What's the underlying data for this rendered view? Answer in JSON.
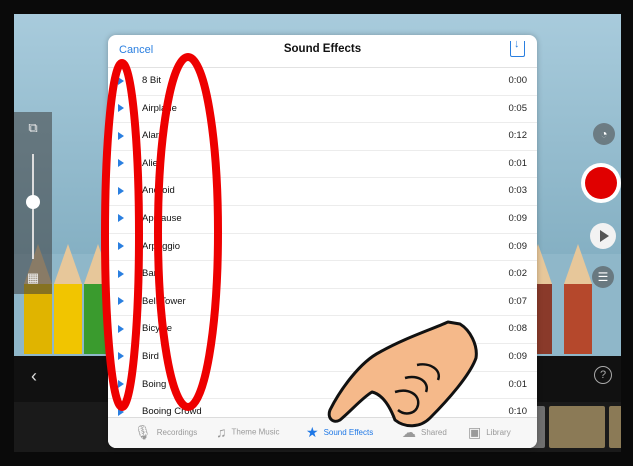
{
  "header": {
    "cancel_label": "Cancel",
    "title": "Sound Effects",
    "import_icon": "import-icon"
  },
  "sounds": [
    {
      "name": "8 Bit",
      "duration": "0:00"
    },
    {
      "name": "Airplane",
      "duration": "0:05"
    },
    {
      "name": "Alarm",
      "duration": "0:12"
    },
    {
      "name": "Alien",
      "duration": "0:01"
    },
    {
      "name": "Android",
      "duration": "0:03"
    },
    {
      "name": "Applause",
      "duration": "0:09"
    },
    {
      "name": "Arpeggio",
      "duration": "0:09"
    },
    {
      "name": "Bark",
      "duration": "0:02"
    },
    {
      "name": "Bell Tower",
      "duration": "0:07"
    },
    {
      "name": "Bicycle",
      "duration": "0:08"
    },
    {
      "name": "Bird",
      "duration": "0:09"
    },
    {
      "name": "Boing",
      "duration": "0:01"
    },
    {
      "name": "Booing Crowd",
      "duration": "0:10"
    }
  ],
  "tabs": [
    {
      "label": "Recordings",
      "icon": "microphone-icon",
      "active": false
    },
    {
      "label": "Theme Music",
      "icon": "music-note-icon",
      "active": false
    },
    {
      "label": "Sound Effects",
      "icon": "star-icon",
      "active": true
    },
    {
      "label": "Shared",
      "icon": "shared-icon",
      "active": false
    },
    {
      "label": "Library",
      "icon": "library-icon",
      "active": false
    }
  ],
  "colors": {
    "accent": "#1f78e6",
    "annotation": "#ee0000",
    "record": "#e00000"
  }
}
